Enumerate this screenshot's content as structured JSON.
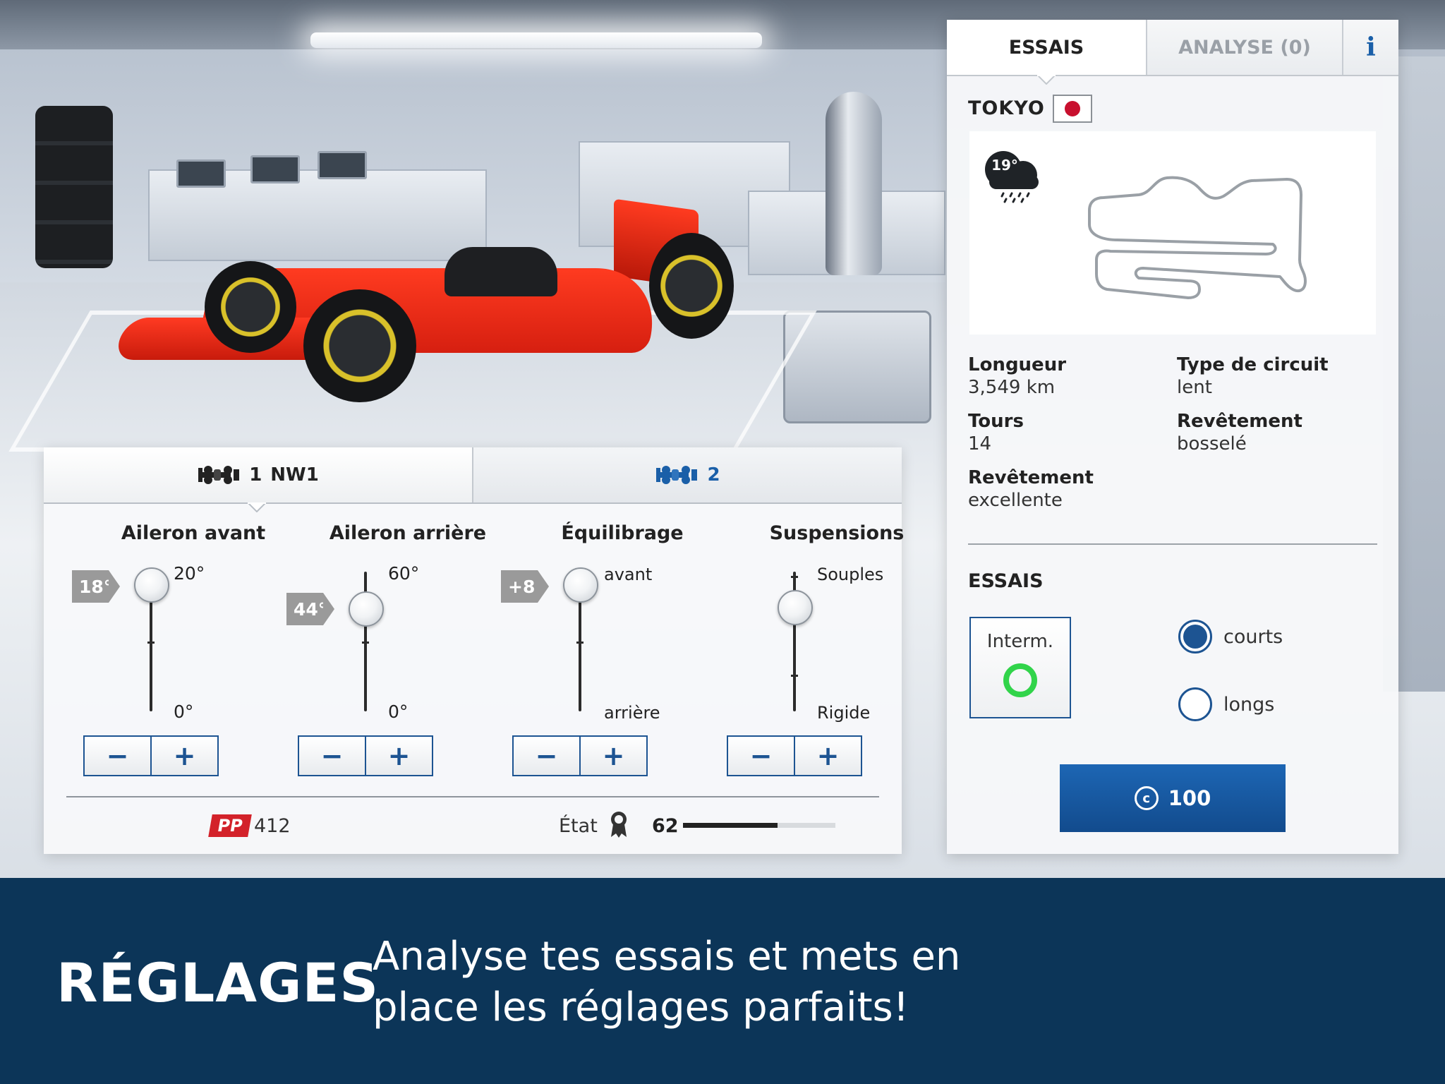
{
  "setup_panel": {
    "tabs": [
      {
        "number": "1",
        "name": "NW1",
        "icon": "car-icon",
        "active": true
      },
      {
        "number": "2",
        "icon": "car-icon",
        "active": false
      }
    ],
    "columns": [
      {
        "title": "Aileron avant",
        "value_tag": "18°",
        "top_label": "20°",
        "bottom_label": "0°",
        "level": 0.9
      },
      {
        "title": "Aileron arrière",
        "value_tag": "44°",
        "top_label": "60°",
        "bottom_label": "0°",
        "level": 0.73
      },
      {
        "title": "Équilibrage",
        "value_tag": "+8",
        "top_label": "avant",
        "bottom_label": "arrière",
        "level": 0.9
      },
      {
        "title": "Suspensions",
        "value_tag": "",
        "top_label": "Souples",
        "bottom_label": "Rigide",
        "level": 0.83
      }
    ],
    "stepper": {
      "minus": "−",
      "plus": "+"
    },
    "pp_badge": "PP",
    "pp_value": "412",
    "etat_label": "État",
    "etat_value": "62",
    "etat_fraction": 0.62
  },
  "right_panel": {
    "tabs": {
      "essais": "ESSAIS",
      "analyse": "ANALYSE (0)",
      "info": "i"
    },
    "city": "TOKYO",
    "flag_color": "#c8102e",
    "weather": {
      "icon": "rain-cloud-icon",
      "temperature": "19°"
    },
    "info": [
      {
        "key": "Longueur",
        "value": "3,549 km"
      },
      {
        "key": "Type de circuit",
        "value": "lent"
      },
      {
        "key": "Tours",
        "value": "14"
      },
      {
        "key": "Revêtement",
        "value": "bosselé"
      },
      {
        "key": "Revêtement",
        "value": "excellente"
      }
    ],
    "essais_title": "ESSAIS",
    "tyre_label": "Interm.",
    "radio_options": [
      {
        "label": "courts",
        "selected": true
      },
      {
        "label": "longs",
        "selected": false
      }
    ],
    "buy": {
      "icon": "coin-icon",
      "value": "100"
    }
  },
  "footer": {
    "title": "RÉGLAGES",
    "line1": "Analyse tes essais et mets en",
    "line2": "place les réglages parfaits!"
  },
  "colors": {
    "accent_blue": "#1d5492",
    "footer_bg": "#0c3558",
    "pp_red": "#d3222a",
    "tyre_green": "#31d44a"
  }
}
